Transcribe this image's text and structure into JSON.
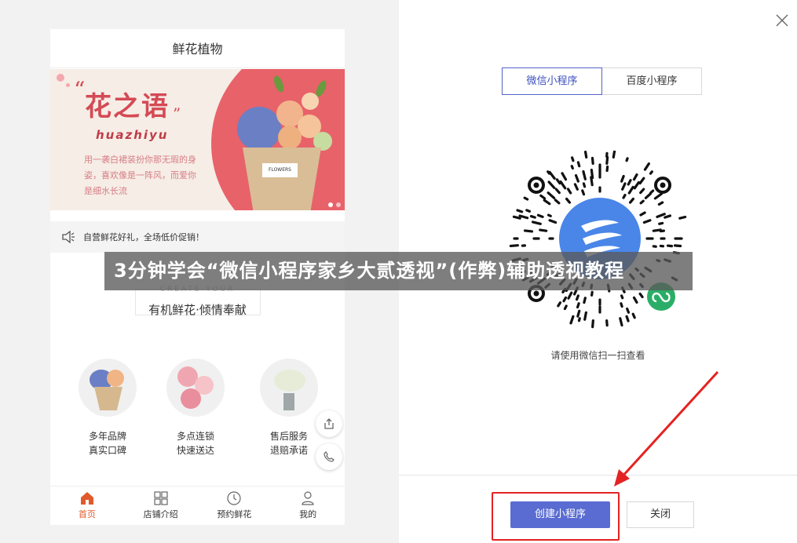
{
  "preview": {
    "title": "鲜花植物",
    "banner": {
      "logo_text": "花之语",
      "pinyin": "huazhiyu",
      "desc": "用一袭白裙装扮你那无瑕的身姿，喜欢像是一阵风，而爱你是细水长流",
      "tag_text": "FLOWERS"
    },
    "notice": "自营鲜花好礼，全场低价促销！",
    "section": {
      "subtitle": "CREATE YOUR",
      "title": "有机鲜花·倾情奉献"
    },
    "features": [
      {
        "line1": "多年品牌",
        "line2": "真实口碑"
      },
      {
        "line1": "多点连锁",
        "line2": "快速送达"
      },
      {
        "line1": "售后服务",
        "line2": "退赔承诺"
      }
    ],
    "tabs": [
      {
        "label": "首页",
        "icon": "home-icon",
        "active": true
      },
      {
        "label": "店铺介绍",
        "icon": "grid-icon",
        "active": false
      },
      {
        "label": "预约鲜花",
        "icon": "clock-icon",
        "active": false
      },
      {
        "label": "我的",
        "icon": "user-icon",
        "active": false
      }
    ]
  },
  "panel": {
    "segments": [
      "微信小程序",
      "百度小程序"
    ],
    "scan_hint": "请使用微信扫一扫查看",
    "create_button": "创建小程序",
    "close_button": "关闭"
  },
  "overlay_title": "3分钟学会“微信小程序家乡大贰透视”(作弊)辅助透视教程",
  "colors": {
    "accent": "#5a6cd1",
    "tab_active": "#e05a2b",
    "annotation_red": "#e52222",
    "banner_pink": "#e8626a"
  }
}
